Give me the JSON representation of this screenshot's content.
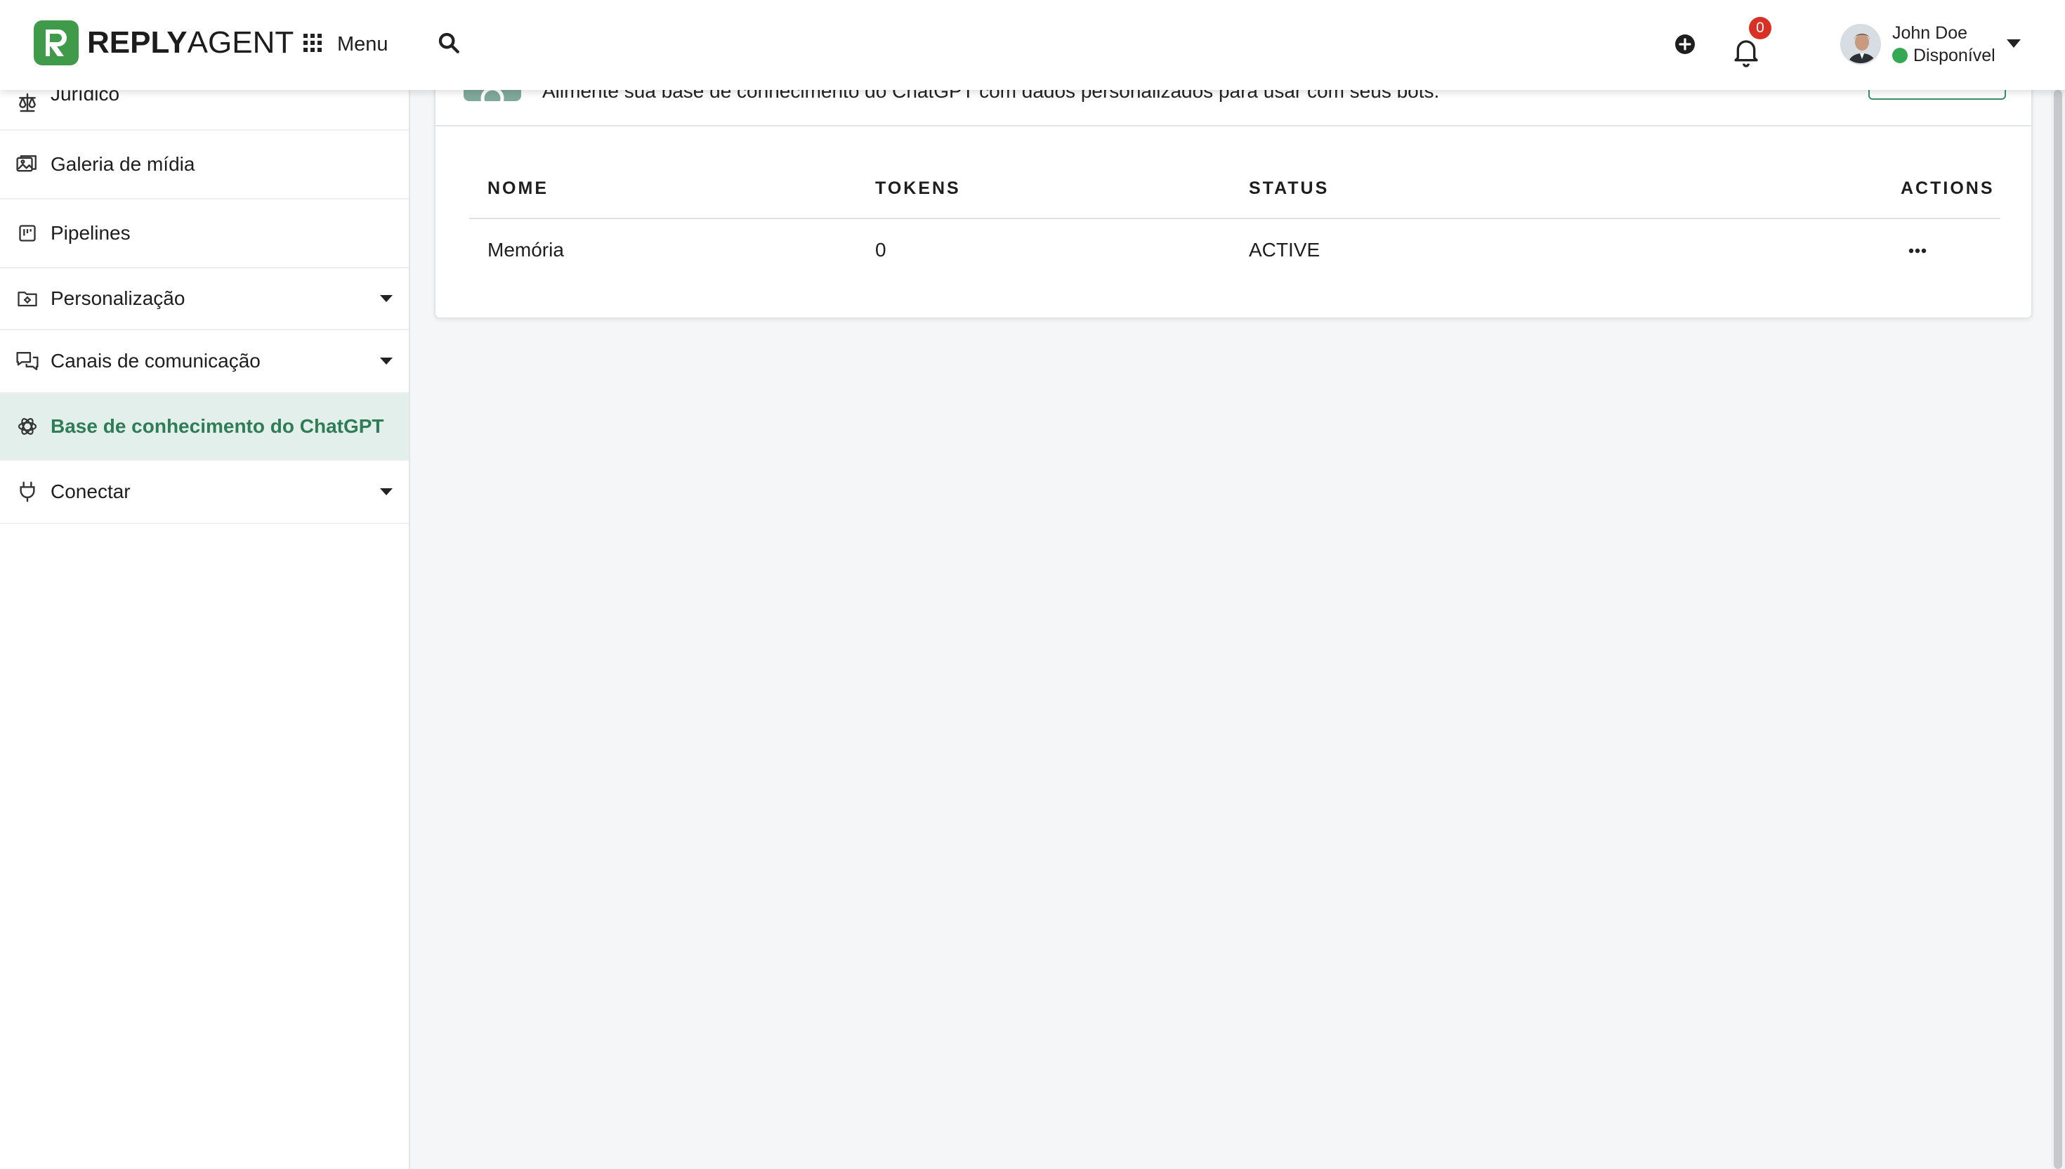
{
  "app": {
    "logo_bold": "REPLY",
    "logo_light": "AGENT"
  },
  "header": {
    "menu_label": "Menu",
    "notification_count": "0",
    "user": {
      "name": "John Doe",
      "status": "Disponível",
      "status_color": "#34a853"
    }
  },
  "sidebar": {
    "items": [
      {
        "label": "Jurídico",
        "icon": "scale-icon"
      },
      {
        "label": "Galeria de mídia",
        "icon": "media-gallery-icon"
      },
      {
        "label": "Pipelines",
        "icon": "pipeline-icon"
      },
      {
        "label": "Personalização",
        "icon": "folder-gear-icon",
        "expandable": true
      },
      {
        "label": "Canais de comunicação",
        "icon": "chat-channels-icon",
        "expandable": true
      },
      {
        "label": "Base de conhecimento do ChatGPT",
        "icon": "openai-icon",
        "active": true
      },
      {
        "label": "Conectar",
        "icon": "plug-icon",
        "expandable": true
      }
    ]
  },
  "main": {
    "description": "Alimente sua base de conhecimento do ChatGPT com dados personalizados para usar com seus bots.",
    "table": {
      "columns": [
        "NOME",
        "TOKENS",
        "STATUS",
        "ACTIONS"
      ],
      "rows": [
        {
          "nome": "Memória",
          "tokens": "0",
          "status": "ACTIVE"
        }
      ]
    }
  },
  "colors": {
    "brand": "#3f9a4a",
    "active_text": "#2e7d57",
    "active_bg": "#e3efea",
    "badge": "#d93025"
  }
}
